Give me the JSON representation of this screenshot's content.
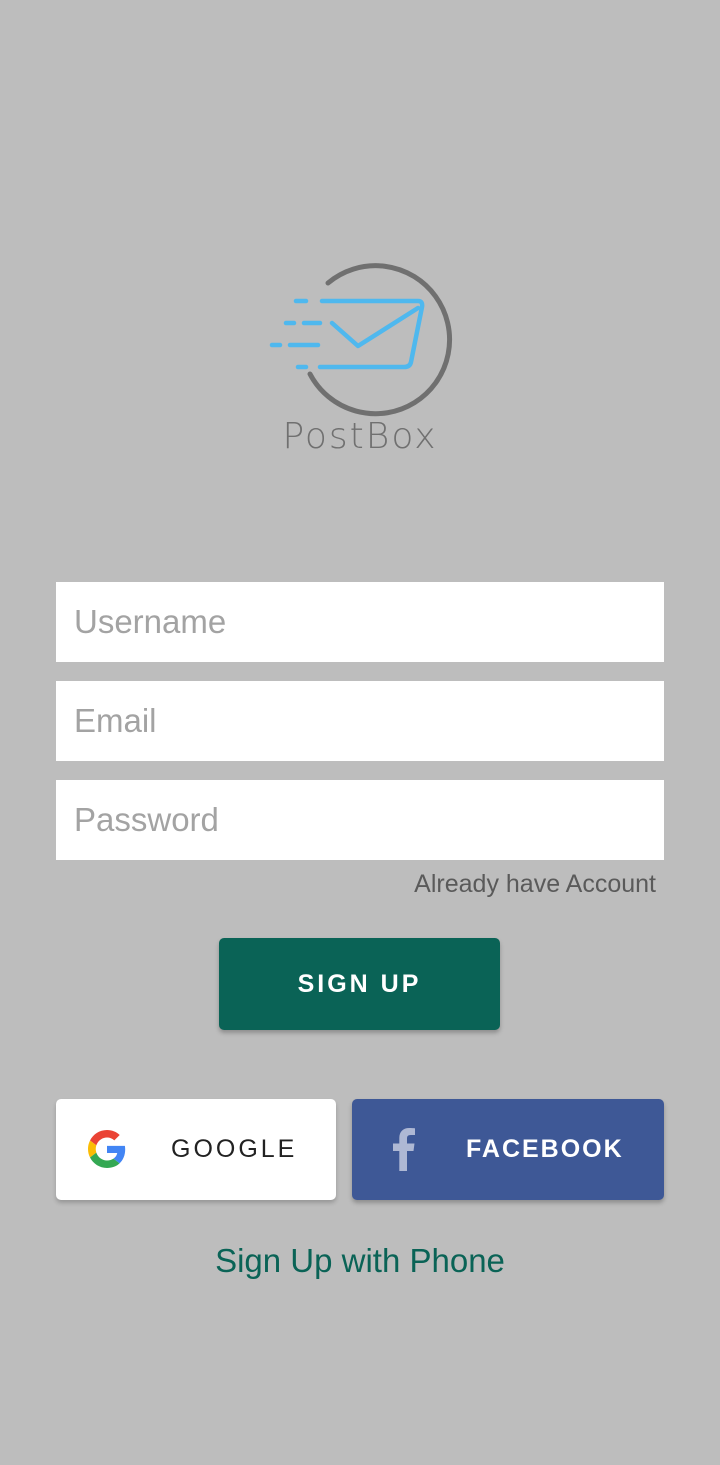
{
  "app": {
    "logo_text": "PostBox"
  },
  "form": {
    "username": {
      "value": "",
      "placeholder": "Username"
    },
    "email": {
      "value": "",
      "placeholder": "Email"
    },
    "password": {
      "value": "",
      "placeholder": "Password"
    },
    "already_account_link": "Already have Account",
    "signup_button": "SIGN UP"
  },
  "social": {
    "google_label": "GOOGLE",
    "facebook_label": "FACEBOOK"
  },
  "phone_signup_link": "Sign Up with Phone",
  "icons": {
    "logo": "postbox-envelope-logo",
    "google": "google-g-icon",
    "facebook": "facebook-f-icon"
  },
  "colors": {
    "background": "#bdbdbd",
    "primary": "#0a6356",
    "facebook": "#3e5896",
    "logo_blue": "#4fb8ee",
    "logo_gray": "#707070"
  }
}
